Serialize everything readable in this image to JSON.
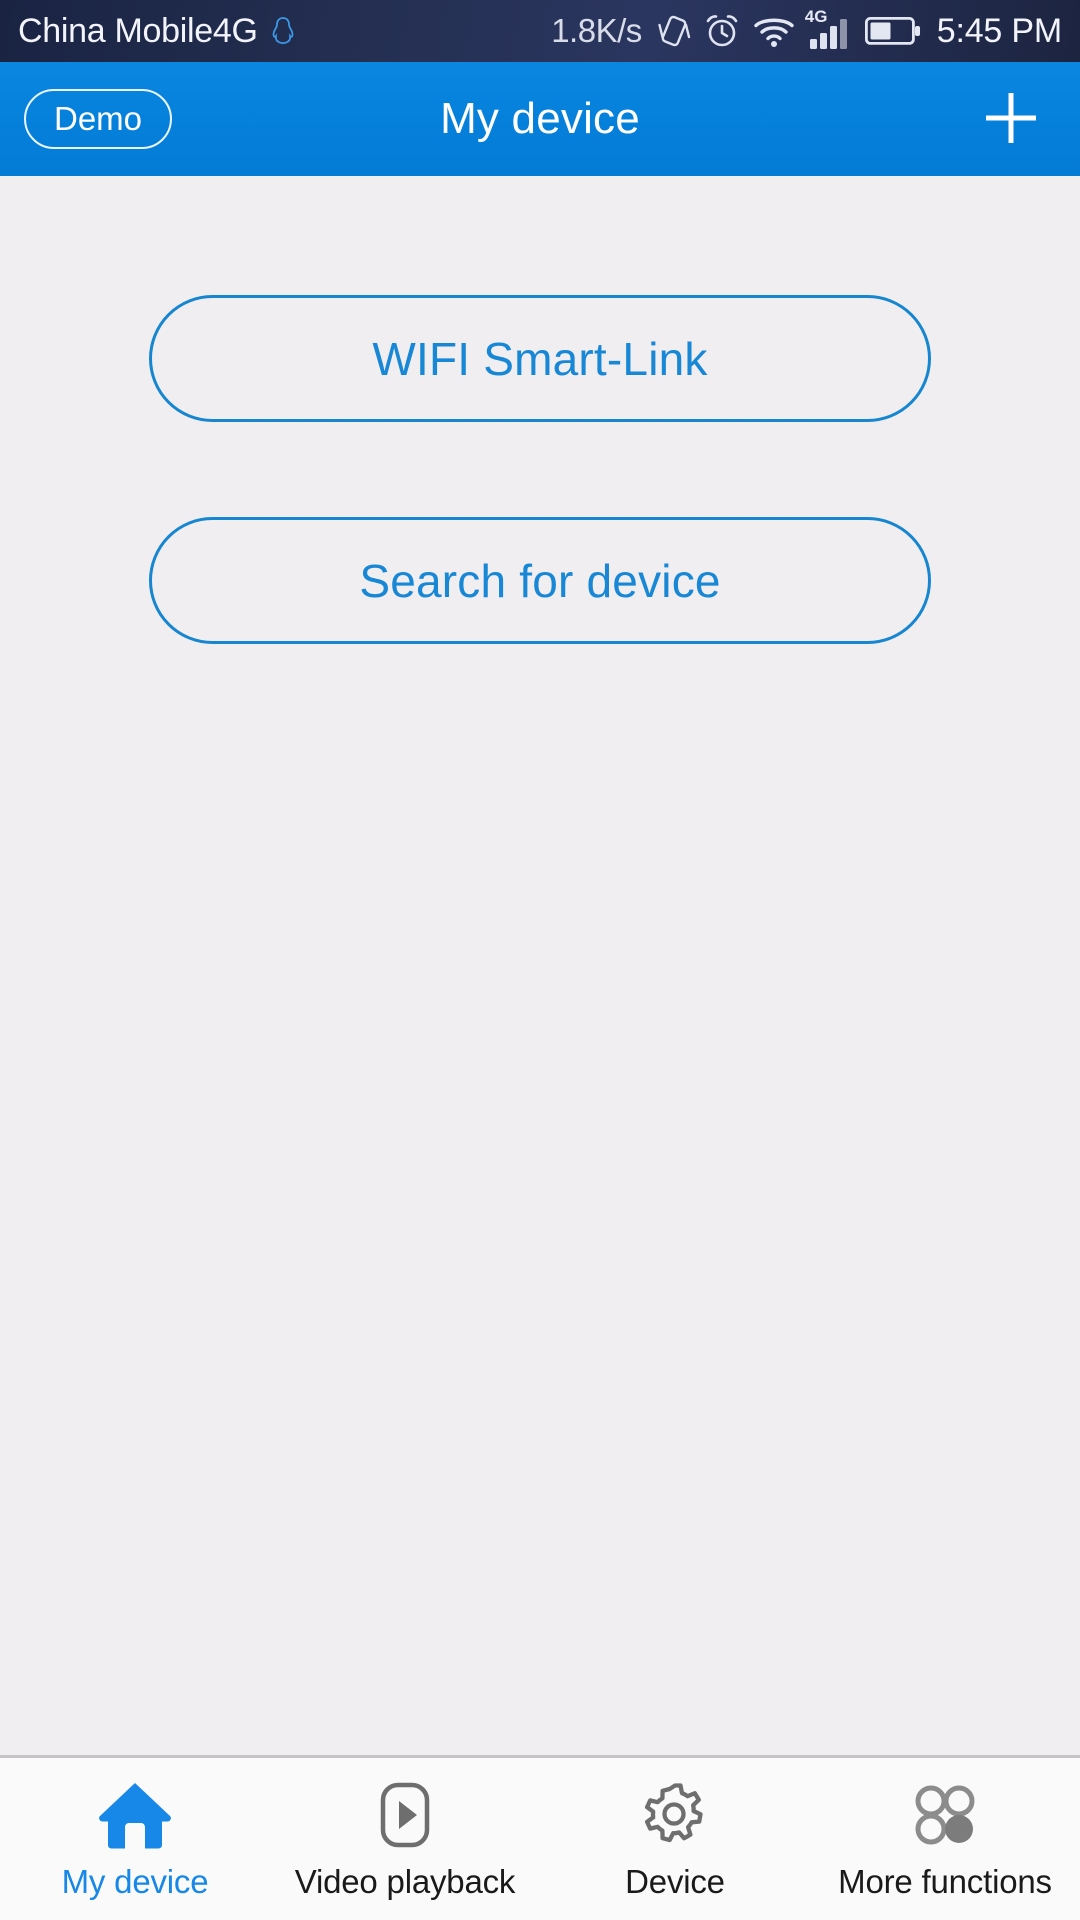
{
  "status_bar": {
    "carrier": "China Mobile4G",
    "qq_icon": "qq-penguin-icon",
    "network_speed": "1.8K/s",
    "vibrate_icon": "vibrate-icon",
    "alarm_icon": "alarm-clock-icon",
    "wifi_icon": "wifi-icon",
    "network_type": "4G",
    "signal_icon": "signal-bars-icon",
    "signal_bars_filled": 3,
    "signal_bars_total": 4,
    "battery_icon": "battery-icon",
    "battery_level_percent": 48,
    "time": "5:45 PM"
  },
  "header": {
    "demo_label": "Demo",
    "title": "My device",
    "add_icon": "plus-icon"
  },
  "main": {
    "buttons": [
      {
        "label": "WIFI Smart-Link",
        "name": "wifi-smart-link-button"
      },
      {
        "label": "Search for device",
        "name": "search-for-device-button"
      }
    ]
  },
  "tab_bar": {
    "items": [
      {
        "label": "My device",
        "icon": "home-icon",
        "active": true
      },
      {
        "label": "Video playback",
        "icon": "play-icon",
        "active": false
      },
      {
        "label": "Device",
        "icon": "gear-icon",
        "active": false
      },
      {
        "label": "More functions",
        "icon": "grid-dots-icon",
        "active": false
      }
    ]
  },
  "colors": {
    "accent_blue": "#0580db",
    "outline_blue": "#1686d0",
    "text_blue": "#1787d6",
    "active_tab_blue": "#1787e8",
    "page_background": "#f0eef1",
    "status_bar_dark": "#242f52",
    "tab_bar_background": "#fafafa"
  }
}
